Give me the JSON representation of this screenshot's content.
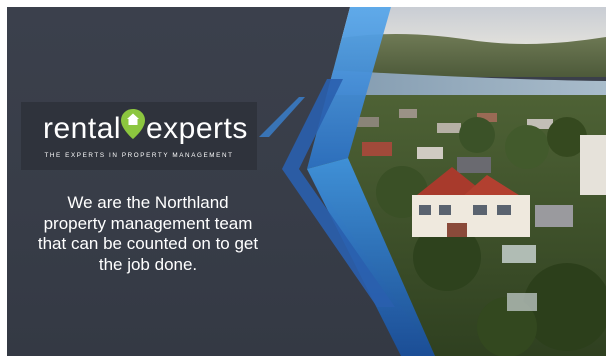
{
  "logo": {
    "word_left": "rental",
    "word_right": "experts",
    "tagline": "THE EXPERTS IN PROPERTY MANAGEMENT"
  },
  "headline": {
    "lines": [
      "We are the Northland",
      "property management team",
      "that can be counted on to get",
      "the job done."
    ]
  },
  "colors": {
    "panel_bg": "#3a3f4a",
    "accent_blue": "#3a8fd8",
    "accent_blue_dark": "#1e5fa8",
    "logo_green": "#8cc63f"
  },
  "icons": [
    "house-pin-icon"
  ]
}
